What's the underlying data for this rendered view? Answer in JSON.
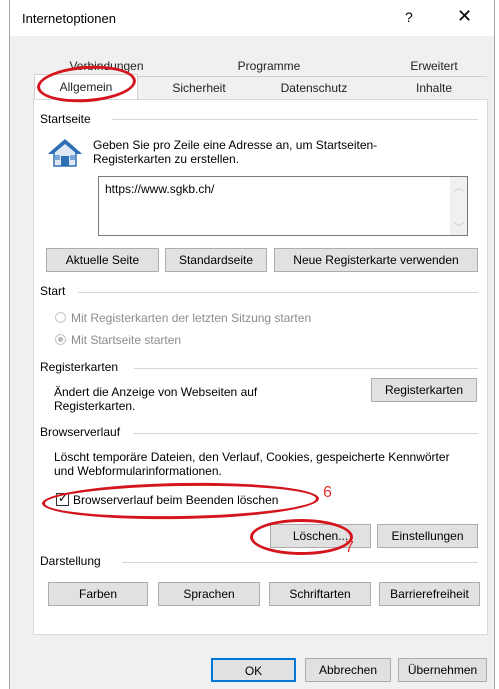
{
  "window": {
    "title": "Internetoptionen",
    "help_label": "?",
    "close_label": "✕"
  },
  "tabs": {
    "back_row": [
      "Verbindungen",
      "Programme",
      "Erweitert"
    ],
    "front_row": [
      "Allgemein",
      "Sicherheit",
      "Datenschutz",
      "Inhalte"
    ],
    "active": "Allgemein"
  },
  "startseite": {
    "header": "Startseite",
    "description": "Geben Sie pro Zeile eine Adresse an, um Startseiten-Registerkarten zu erstellen.",
    "url_value": "https://www.sgkb.ch/",
    "buttons": [
      "Aktuelle Seite",
      "Standardseite",
      "Neue Registerkarte verwenden"
    ]
  },
  "start": {
    "header": "Start",
    "options": [
      "Mit Registerkarten der letzten Sitzung starten",
      "Mit Startseite starten"
    ],
    "selected": "Mit Startseite starten"
  },
  "registerkarten": {
    "header": "Registerkarten",
    "description": "Ändert die Anzeige von Webseiten auf Registerkarten.",
    "button": "Registerkarten"
  },
  "browserverlauf": {
    "header": "Browserverlauf",
    "description": "Löscht temporäre Dateien, den Verlauf, Cookies, gespeicherte Kennwörter und Webformularinformationen.",
    "checkbox_label": "Browserverlauf beim Beenden löschen",
    "checkbox_checked": true,
    "delete_button": "Löschen...",
    "settings_button": "Einstellungen",
    "annotation_6": "6",
    "annotation_7": "7"
  },
  "darstellung": {
    "header": "Darstellung",
    "buttons": [
      "Farben",
      "Sprachen",
      "Schriftarten",
      "Barrierefreiheit"
    ]
  },
  "footer": {
    "ok": "OK",
    "cancel": "Abbrechen",
    "apply": "Übernehmen"
  },
  "colors": {
    "annotation_red": "#d5151d",
    "house_blue": "#2f6fb5"
  },
  "icons": {
    "home": "home-icon",
    "scroll_up": "scroll-up-icon",
    "scroll_down": "scroll-down-icon"
  }
}
